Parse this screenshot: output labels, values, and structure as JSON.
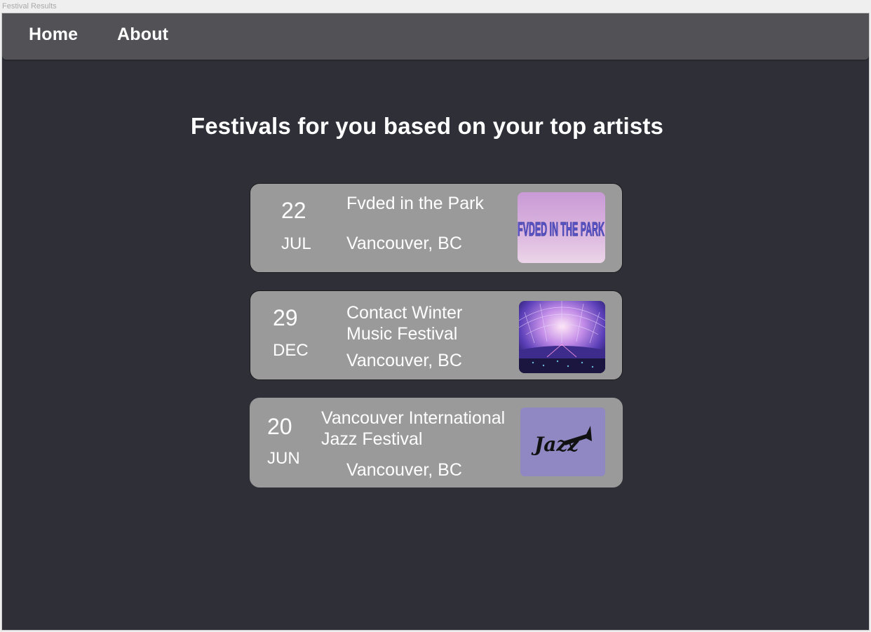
{
  "window": {
    "title": "Festival Results"
  },
  "nav": {
    "home_label": "Home",
    "about_label": "About"
  },
  "page": {
    "heading": "Festivals for you based on your top artists"
  },
  "festivals": [
    {
      "day": "22",
      "month": "JUL",
      "name_lines": [
        "Fvded in the Park"
      ],
      "location": "Vancouver, BC",
      "image_label": "FVDED IN THE PARK",
      "image_icon": "fvded-logo-image"
    },
    {
      "day": "29",
      "month": "DEC",
      "name_lines": [
        "Contact Winter",
        "Music Festival"
      ],
      "location": "Vancouver, BC",
      "image_icon": "stadium-concert-image"
    },
    {
      "day": "20",
      "month": "JUN",
      "name_lines": [
        "Vancouver International",
        "Jazz Festival"
      ],
      "location": "Vancouver, BC",
      "image_label": "Jazz",
      "image_icon": "jazz-logo-image"
    }
  ],
  "colors": {
    "background": "#2f2f37",
    "navbar": "#525156",
    "card": "#9a9a9a",
    "text": "#ffffff"
  }
}
